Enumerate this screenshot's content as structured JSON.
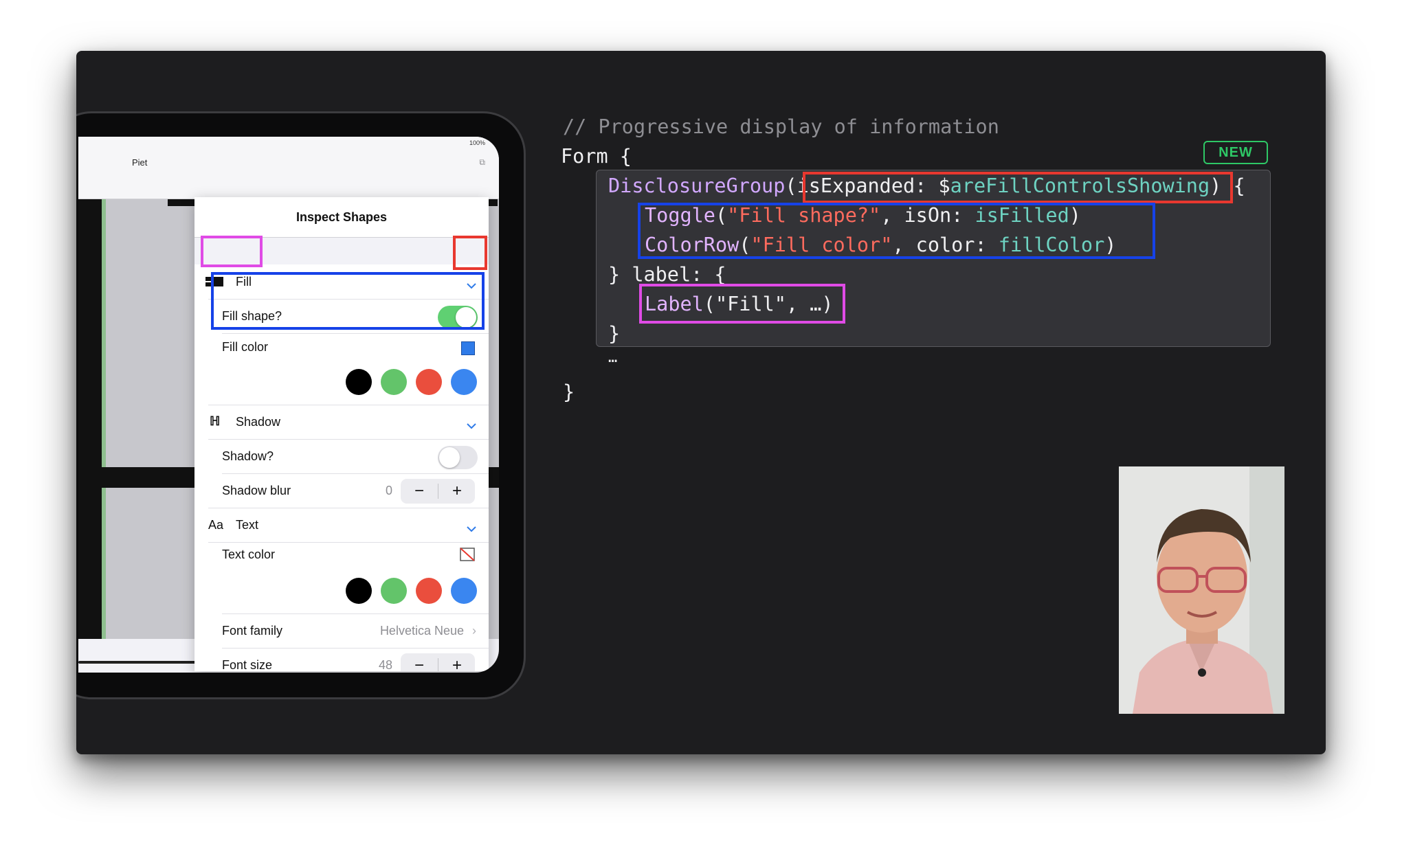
{
  "ipad": {
    "status_text": "100%",
    "nav_title": "Piet",
    "popover": {
      "title": "Inspect Shapes",
      "sections": {
        "fill": {
          "label": "Fill",
          "fill_shape_label": "Fill shape?",
          "fill_shape_on": true,
          "fill_color_label": "Fill color",
          "fill_color_value": "#2f7be8"
        },
        "shadow": {
          "label": "Shadow",
          "shadow_toggle_label": "Shadow?",
          "shadow_on": false,
          "blur_label": "Shadow blur",
          "blur_value": "0"
        },
        "text": {
          "label": "Text",
          "icon_text": "Aa",
          "text_color_label": "Text color",
          "font_family_label": "Font family",
          "font_family_value": "Helvetica Neue",
          "font_size_label": "Font size",
          "font_size_value": "48"
        }
      },
      "swatches": [
        "#000000",
        "#63c46a",
        "#ea4e3d",
        "#3a86f0"
      ],
      "stepper": {
        "minus": "−",
        "plus": "+"
      }
    }
  },
  "code": {
    "comment": "// Progressive display of information",
    "badge": "NEW",
    "form_open": "Form {",
    "disclosure": {
      "name": "DisclosureGroup",
      "paren_open": "(",
      "arg": "isExpanded: $",
      "binding": "areFillControlsShowing",
      "close": ") {"
    },
    "toggle": {
      "name": "Toggle",
      "paren_open": "(",
      "string": "\"Fill shape?\"",
      "mid": ", isOn: ",
      "binding": "isFilled",
      "close": ")"
    },
    "colorrow": {
      "name": "ColorRow",
      "paren_open": "(",
      "string": "\"Fill color\"",
      "mid": ", color: ",
      "binding": "fillColor",
      "close": ")"
    },
    "label_line": "} label: {",
    "label_call": {
      "name": "Label",
      "rest": "(\"Fill\", …)"
    },
    "inner_close": "}",
    "ellipsis": "…",
    "outer_close": "}"
  },
  "colors": {
    "highlight_red": "#e8382f",
    "highlight_blue": "#1642e8",
    "highlight_magenta": "#e04be6",
    "accent_green": "#2ec866",
    "toggle_on": "#5fd072"
  }
}
